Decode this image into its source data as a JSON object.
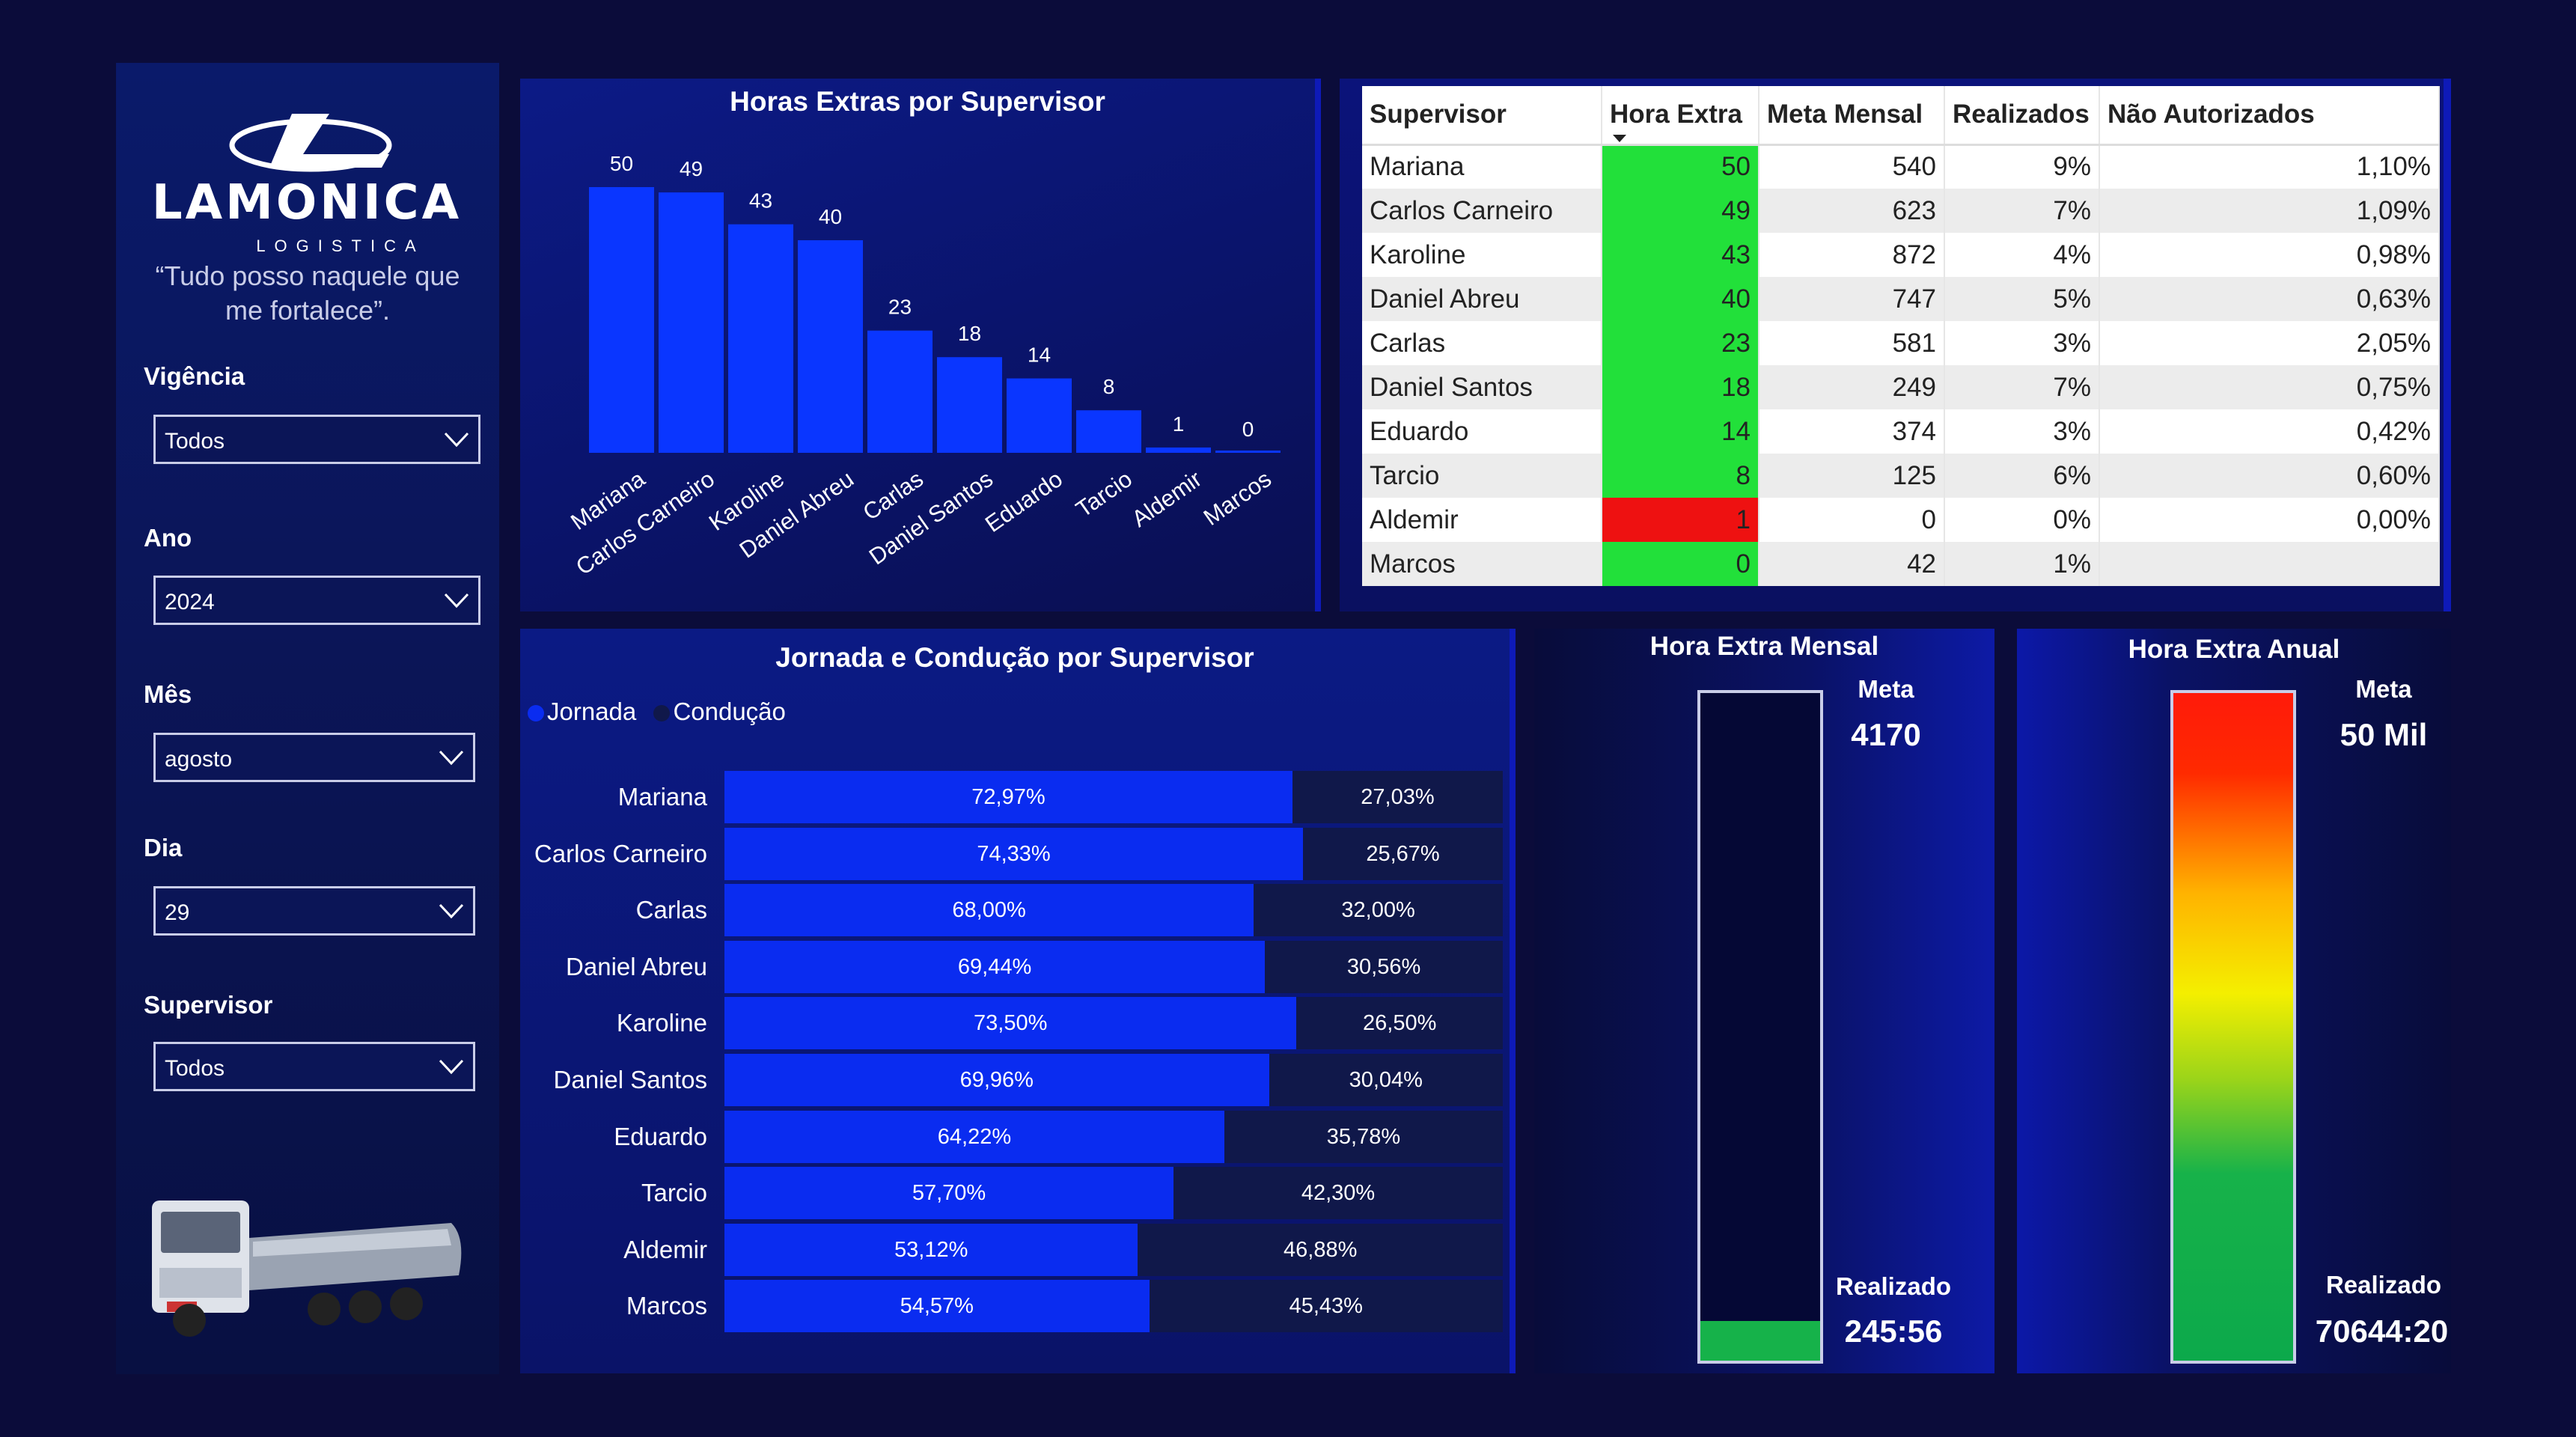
{
  "sidebar": {
    "logo": {
      "brand": "LAMONICA",
      "sub": "LOGISTICA"
    },
    "quote": "“Tudo posso naquele que me fortalece”.",
    "filters": [
      {
        "label": "Vigência",
        "value": "Todos"
      },
      {
        "label": "Ano",
        "value": "2024"
      },
      {
        "label": "Mês",
        "value": "agosto"
      },
      {
        "label": "Dia",
        "value": "29"
      },
      {
        "label": "Supervisor",
        "value": "Todos"
      }
    ]
  },
  "bar_panel": {
    "title": "Horas Extras por Supervisor"
  },
  "table": {
    "headers": [
      "Supervisor",
      "Hora Extra",
      "Meta Mensal",
      "Realizados",
      "Não Autorizados"
    ],
    "rows": [
      {
        "supervisor": "Mariana",
        "hora_extra": "50",
        "meta": "540",
        "realizados": "9%",
        "nao_aut": "1,10%",
        "status": "green"
      },
      {
        "supervisor": "Carlos Carneiro",
        "hora_extra": "49",
        "meta": "623",
        "realizados": "7%",
        "nao_aut": "1,09%",
        "status": "green"
      },
      {
        "supervisor": "Karoline",
        "hora_extra": "43",
        "meta": "872",
        "realizados": "4%",
        "nao_aut": "0,98%",
        "status": "green"
      },
      {
        "supervisor": "Daniel Abreu",
        "hora_extra": "40",
        "meta": "747",
        "realizados": "5%",
        "nao_aut": "0,63%",
        "status": "green"
      },
      {
        "supervisor": "Carlas",
        "hora_extra": "23",
        "meta": "581",
        "realizados": "3%",
        "nao_aut": "2,05%",
        "status": "green"
      },
      {
        "supervisor": "Daniel Santos",
        "hora_extra": "18",
        "meta": "249",
        "realizados": "7%",
        "nao_aut": "0,75%",
        "status": "green"
      },
      {
        "supervisor": "Eduardo",
        "hora_extra": "14",
        "meta": "374",
        "realizados": "3%",
        "nao_aut": "0,42%",
        "status": "green"
      },
      {
        "supervisor": "Tarcio",
        "hora_extra": "8",
        "meta": "125",
        "realizados": "6%",
        "nao_aut": "0,60%",
        "status": "green"
      },
      {
        "supervisor": "Aldemir",
        "hora_extra": "1",
        "meta": "0",
        "realizados": "0%",
        "nao_aut": "0,00%",
        "status": "red"
      },
      {
        "supervisor": "Marcos",
        "hora_extra": "0",
        "meta": "42",
        "realizados": "1%",
        "nao_aut": "",
        "status": "green"
      }
    ],
    "colors": {
      "green": "#22e03a",
      "red": "#ee1111"
    }
  },
  "hbar_panel": {
    "title": "Jornada e Condução por Supervisor",
    "legend": [
      {
        "name": "Jornada",
        "color": "#0a2cf0"
      },
      {
        "name": "Condução",
        "color": "#10184a"
      }
    ]
  },
  "mensal": {
    "title": "Hora Extra Mensal",
    "meta_label": "Meta",
    "meta_value": "4170",
    "realizado_label": "Realizado",
    "realizado_value": "245:56",
    "fill_fraction": 0.059
  },
  "anual": {
    "title": "Hora Extra Anual",
    "meta_label": "Meta",
    "meta_value": "50 Mil",
    "realizado_label": "Realizado",
    "realizado_value": "70644:20",
    "fill_fraction": 1.0
  },
  "chart_data": [
    {
      "type": "bar",
      "title": "Horas Extras por Supervisor",
      "categories": [
        "Mariana",
        "Carlos Carneiro",
        "Karoline",
        "Daniel Abreu",
        "Carlas",
        "Daniel Santos",
        "Eduardo",
        "Tarcio",
        "Aldemir",
        "Marcos"
      ],
      "values": [
        50,
        49,
        43,
        40,
        23,
        18,
        14,
        8,
        1,
        0
      ],
      "ylim": [
        0,
        50
      ],
      "color": "#0a36ff"
    },
    {
      "type": "bar",
      "orientation": "horizontal",
      "stacked": "100%",
      "title": "Jornada e Condução por Supervisor",
      "categories": [
        "Mariana",
        "Carlos Carneiro",
        "Carlas",
        "Daniel Abreu",
        "Karoline",
        "Daniel Santos",
        "Eduardo",
        "Tarcio",
        "Aldemir",
        "Marcos"
      ],
      "series": [
        {
          "name": "Jornada",
          "values": [
            72.97,
            74.33,
            68.0,
            69.44,
            73.5,
            69.96,
            64.22,
            57.7,
            53.12,
            54.57
          ],
          "labels": [
            "72,97%",
            "74,33%",
            "68,00%",
            "69,44%",
            "73,50%",
            "69,96%",
            "64,22%",
            "57,70%",
            "53,12%",
            "54,57%"
          ]
        },
        {
          "name": "Condução",
          "values": [
            27.03,
            25.67,
            32.0,
            30.56,
            26.5,
            30.04,
            35.78,
            42.3,
            46.88,
            45.43
          ],
          "labels": [
            "27,03%",
            "25,67%",
            "32,00%",
            "30,56%",
            "26,50%",
            "30,04%",
            "35,78%",
            "42,30%",
            "46,88%",
            "45,43%"
          ]
        }
      ],
      "legend": "top-left"
    }
  ]
}
